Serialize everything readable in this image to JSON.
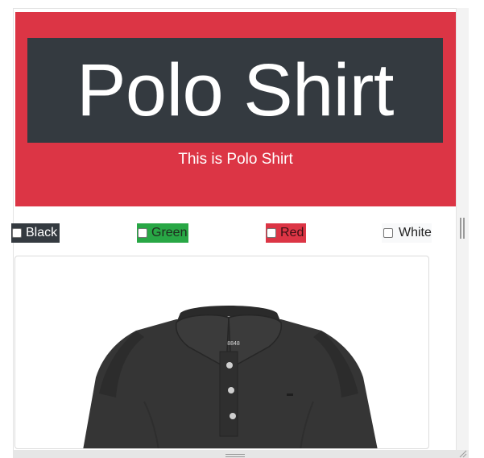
{
  "hero": {
    "title": "Polo Shirt",
    "subtitle": "This is Polo Shirt"
  },
  "color_options": [
    {
      "label": "Black",
      "checked": false,
      "color": "#343a40"
    },
    {
      "label": "Green",
      "checked": false,
      "color": "#28a745"
    },
    {
      "label": "Red",
      "checked": false,
      "color": "#dc3545"
    },
    {
      "label": "White",
      "checked": false,
      "color": "#f8f9fa"
    }
  ],
  "product_image": {
    "icon": "polo-shirt-image",
    "brand_tag": "8848"
  },
  "colors": {
    "hero_bg": "#dc3545",
    "title_box_bg": "#343a40"
  }
}
